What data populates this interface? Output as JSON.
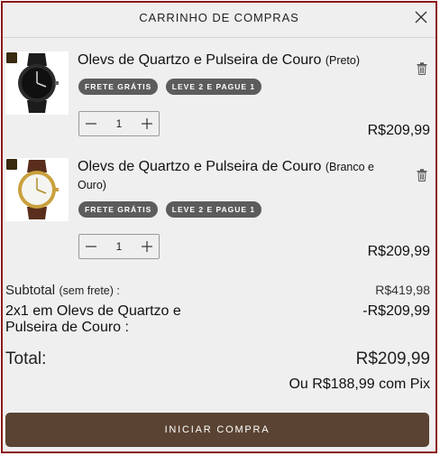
{
  "header": {
    "title": "CARRINHO DE COMPRAS"
  },
  "items": [
    {
      "name": "Olevs de Quartzo e Pulseira de Couro",
      "variant": "(Preto)",
      "tags": [
        "FRETE GRÁTIS",
        "LEVE 2 E PAGUE 1"
      ],
      "quantity": "1",
      "price": "R$209,99",
      "image_icon": "black-watch-image"
    },
    {
      "name": "Olevs de Quartzo e Pulseira de Couro",
      "variant": "(Branco e Ouro)",
      "tags": [
        "FRETE GRÁTIS",
        "LEVE 2 E PAGUE 1"
      ],
      "quantity": "1",
      "price": "R$209,99",
      "image_icon": "gold-watch-image"
    }
  ],
  "summary": {
    "subtotal_label": "Subtotal",
    "subtotal_note": "(sem frete) :",
    "subtotal_value": "R$419,98",
    "promo_label": "2x1 em Olevs de Quartzo e Pulseira de Couro :",
    "promo_value": "-R$209,99",
    "total_label": "Total:",
    "total_value": "R$209,99",
    "pix_text": "Ou R$188,99 com Pix"
  },
  "checkout": {
    "label": "INICIAR COMPRA"
  },
  "colors": {
    "frame_border": "#8b1a1a",
    "panel_bg": "#efefef",
    "tag_bg": "#5c5c5c",
    "checkout_bg": "#5a4332"
  }
}
